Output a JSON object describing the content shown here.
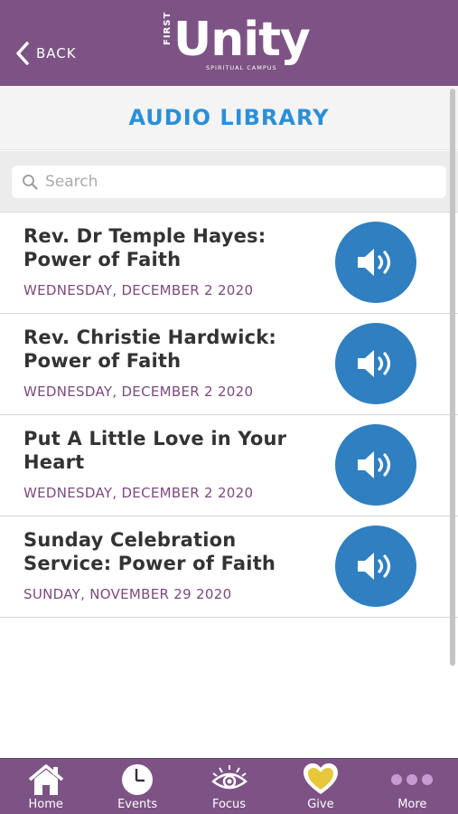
{
  "header": {
    "back_label": "BACK",
    "logo": {
      "prefix": "FIRST",
      "name": "Unity",
      "subtitle": "SPIRITUAL CAMPUS"
    }
  },
  "page_title": "AUDIO LIBRARY",
  "search": {
    "placeholder": "Search",
    "value": ""
  },
  "audio_items": [
    {
      "title": "Rev. Dr Temple Hayes: Power of Faith",
      "date": "WEDNESDAY, DECEMBER 2 2020"
    },
    {
      "title": "Rev. Christie Hardwick: Power of Faith",
      "date": "WEDNESDAY, DECEMBER 2 2020"
    },
    {
      "title": "Put A Little Love in Your Heart",
      "date": "WEDNESDAY, DECEMBER 2 2020"
    },
    {
      "title": "Sunday Celebration Service: Power of Faith",
      "date": "SUNDAY, NOVEMBER 29 2020"
    }
  ],
  "tab_bar": [
    {
      "label": "Home",
      "icon": "home-icon"
    },
    {
      "label": "Events",
      "icon": "clock-icon"
    },
    {
      "label": "Focus",
      "icon": "eye-icon"
    },
    {
      "label": "Give",
      "icon": "heart-icon"
    },
    {
      "label": "More",
      "icon": "more-dots-icon"
    }
  ],
  "colors": {
    "brand_purple": "#7d5385",
    "title_blue": "#2b8fd8",
    "play_blue": "#2f7fc1",
    "date_purple": "#7d4a7d",
    "heart_yellow": "#e6c83a"
  }
}
